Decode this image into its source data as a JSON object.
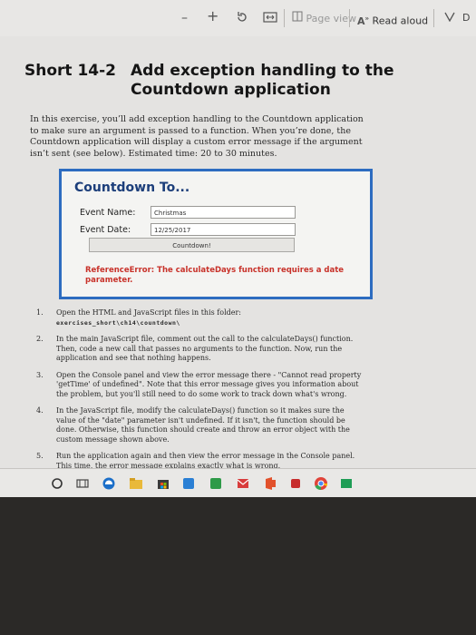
{
  "toolbar": {
    "minus": "–",
    "plus": "+",
    "page_view": "Page view",
    "read_aloud": "Read aloud",
    "cut_letter": "D"
  },
  "heading": {
    "number": "Short 14-2",
    "title": "Add exception handling to the Countdown application"
  },
  "intro": "In this exercise, you’ll add exception handling to the Countdown application to make sure an argument is passed to a function. When you’re done, the Countdown application will display a custom error message if the argument isn’t sent (see below). Estimated time: 20 to 30 minutes.",
  "app": {
    "title": "Countdown To...",
    "event_name_label": "Event Name:",
    "event_name_value": "Christmas",
    "event_date_label": "Event Date:",
    "event_date_value": "12/25/2017",
    "button_label": "Countdown!",
    "error": "ReferenceError: The calculateDays function requires a date parameter."
  },
  "steps": [
    {
      "n": "1.",
      "text": "Open the HTML and JavaScript files in this folder:",
      "path": "exercises_short\\ch14\\countdown\\"
    },
    {
      "n": "2.",
      "text": "In the main JavaScript file, comment out the call to the calculateDays() function. Then, code a new call that passes no arguments to the function. Now, run the application and see that nothing happens."
    },
    {
      "n": "3.",
      "text": "Open the Console panel and view the error message there - \"Cannot read property 'getTime' of undefined\". Note that this error message gives you information about the problem, but you'll still need to do some work to track down what's wrong."
    },
    {
      "n": "4.",
      "text": "In the JavaScript file, modify the calculateDays() function so it makes sure the value of the \"date\" parameter isn't undefined. If it isn't, the function should be done. Otherwise, this function should create and throw an error object with the custom message shown above."
    },
    {
      "n": "5.",
      "text": "Run the application again and then view the error message in the Console panel. This time, the error message explains exactly what is wrong."
    }
  ],
  "colors": {
    "accent_blue": "#2d6cc0",
    "error_red": "#c8322a"
  }
}
